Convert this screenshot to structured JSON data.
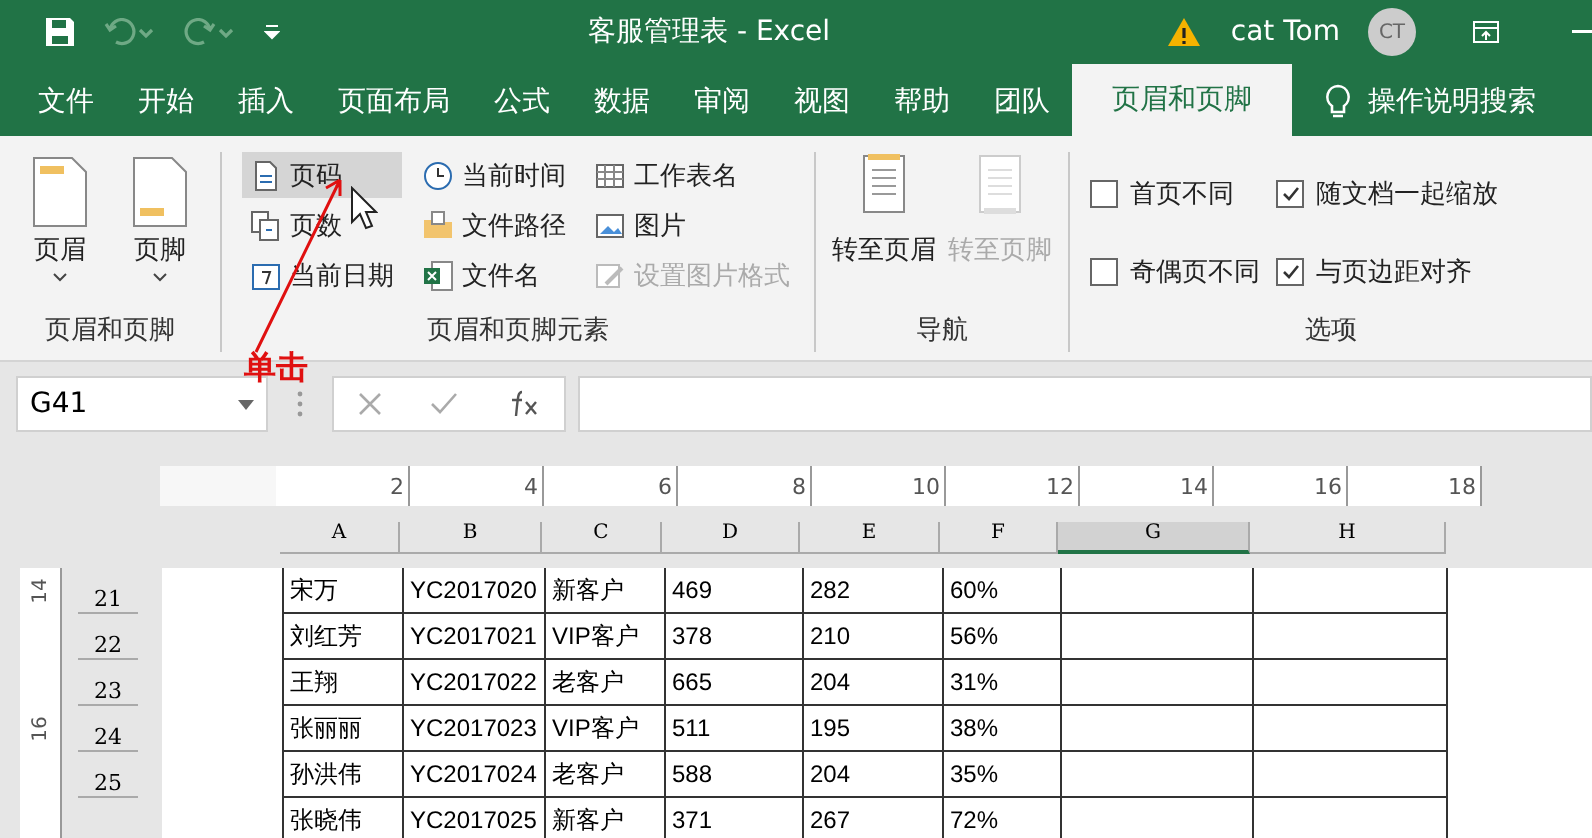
{
  "title_bar": {
    "title": "客服管理表  -  Excel",
    "user": "cat Tom",
    "avatar": "CT"
  },
  "tabs": [
    {
      "label": "文件",
      "selected": false
    },
    {
      "label": "开始",
      "selected": false
    },
    {
      "label": "插入",
      "selected": false
    },
    {
      "label": "页面布局",
      "selected": false
    },
    {
      "label": "公式",
      "selected": false
    },
    {
      "label": "数据",
      "selected": false
    },
    {
      "label": "审阅",
      "selected": false
    },
    {
      "label": "视图",
      "selected": false
    },
    {
      "label": "帮助",
      "selected": false
    },
    {
      "label": "团队",
      "selected": false
    },
    {
      "label": "页眉和页脚",
      "selected": true
    }
  ],
  "tell_me": "操作说明搜索",
  "ribbon": {
    "header_footer": {
      "buttons": [
        "页眉",
        "页脚"
      ],
      "label": "页眉和页脚"
    },
    "elements": {
      "label": "页眉和页脚元素",
      "columns": [
        [
          {
            "label": "页码",
            "hovered": true,
            "disabled": false
          },
          {
            "label": "页数",
            "hovered": false,
            "disabled": false
          },
          {
            "label": "当前日期",
            "hovered": false,
            "disabled": false
          }
        ],
        [
          {
            "label": "当前时间",
            "hovered": false,
            "disabled": false
          },
          {
            "label": "文件路径",
            "hovered": false,
            "disabled": false
          },
          {
            "label": "文件名",
            "hovered": false,
            "disabled": false
          }
        ],
        [
          {
            "label": "工作表名",
            "hovered": false,
            "disabled": false
          },
          {
            "label": "图片",
            "hovered": false,
            "disabled": false
          },
          {
            "label": "设置图片格式",
            "hovered": false,
            "disabled": true
          }
        ]
      ]
    },
    "navigation": {
      "label": "导航",
      "buttons": [
        {
          "label": "转至页眉",
          "disabled": false
        },
        {
          "label": "转至页脚",
          "disabled": true
        }
      ]
    },
    "options": {
      "label": "选项",
      "checkboxes": [
        {
          "label": "首页不同",
          "checked": false
        },
        {
          "label": "奇偶页不同",
          "checked": false
        },
        {
          "label": "随文档一起缩放",
          "checked": true
        },
        {
          "label": "与页边距对齐",
          "checked": true
        }
      ]
    }
  },
  "annotation": {
    "label": "单击"
  },
  "formula_bar": {
    "name_box": "G41"
  },
  "ruler": {
    "labels": [
      "2",
      "4",
      "6",
      "8",
      "10",
      "12",
      "14",
      "16",
      "18"
    ]
  },
  "columns": [
    {
      "label": "A",
      "selected": false
    },
    {
      "label": "B",
      "selected": false
    },
    {
      "label": "C",
      "selected": false
    },
    {
      "label": "D",
      "selected": false
    },
    {
      "label": "E",
      "selected": false
    },
    {
      "label": "F",
      "selected": false
    },
    {
      "label": "G",
      "selected": true
    },
    {
      "label": "H",
      "selected": false
    }
  ],
  "rows": [
    {
      "number": "21",
      "ruler_label": "14",
      "cells": [
        "宋万",
        "YC2017020",
        "新客户",
        "469",
        "282",
        "60%"
      ]
    },
    {
      "number": "22",
      "cells": [
        "刘红芳",
        "YC2017021",
        "VIP客户",
        "378",
        "210",
        "56%"
      ]
    },
    {
      "number": "23",
      "cells": [
        "王翔",
        "YC2017022",
        "老客户",
        "665",
        "204",
        "31%"
      ]
    },
    {
      "number": "24",
      "ruler_label": "16",
      "cells": [
        "张丽丽",
        "YC2017023",
        "VIP客户",
        "511",
        "195",
        "38%"
      ]
    },
    {
      "number": "25",
      "cells": [
        "孙洪伟",
        "YC2017024",
        "老客户",
        "588",
        "204",
        "35%"
      ]
    },
    {
      "cells": [
        "张晓伟",
        "YC2017025",
        "新客户",
        "371",
        "267",
        "72%"
      ]
    }
  ]
}
